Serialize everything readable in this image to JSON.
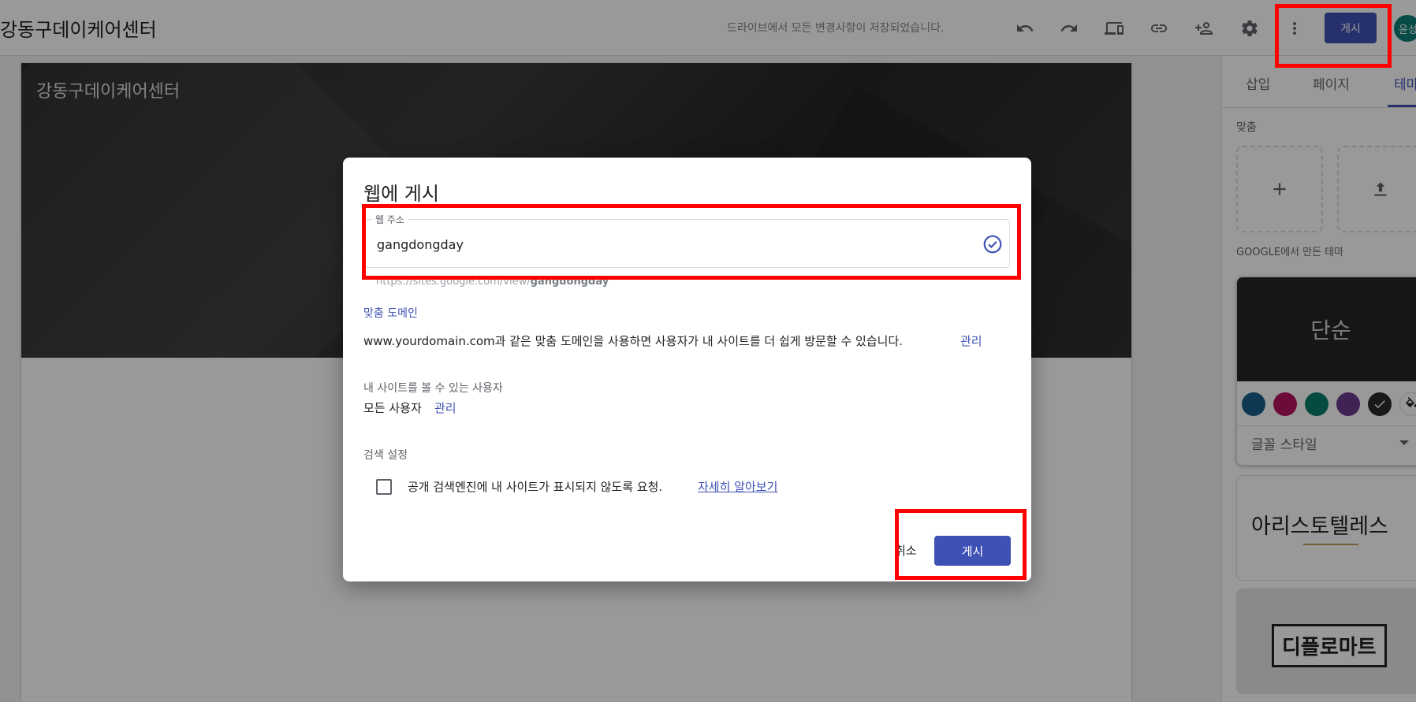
{
  "header": {
    "site_title": "강동구데이케어센터",
    "save_status": "드라이브에서 모든 변경사항이 저장되었습니다.",
    "publish_label": "게시",
    "avatar_text": "윤성",
    "icons": [
      "undo-icon",
      "redo-icon",
      "preview-devices-icon",
      "link-icon",
      "share-person-add-icon",
      "gear-icon",
      "more-vert-icon"
    ]
  },
  "canvas": {
    "header_title": "강동구데이케어센터"
  },
  "side_panel": {
    "tabs": [
      "삽입",
      "페이지",
      "테마"
    ],
    "active_tab": "테마",
    "custom_label": "맞춤",
    "google_themes_label": "GOOGLE에서 만든 테마",
    "themes": {
      "simple_name": "단순",
      "font_style_label": "글꼴 스타일",
      "swatch_colors": [
        "#1a5f8a",
        "#b5135e",
        "#0b7d6a",
        "#6b3a8e",
        "#2a2a2a"
      ],
      "aristotle_name": "아리스토텔레스",
      "diplomat_name": "디플로마트"
    }
  },
  "dialog": {
    "title": "웹에 게시",
    "url_field_label": "웹 주소",
    "url_value": "gangdongday",
    "url_helper_prefix": "https://sites.google.com/view/",
    "url_helper_slug": "gangdongday",
    "custom_domain_label": "맞춤 도메인",
    "custom_domain_text": "www.yourdomain.com과 같은 맞춤 도메인을 사용하면 사용자가 내 사이트를 더 쉽게 방문할 수 있습니다.",
    "custom_domain_manage": "관리",
    "viewers_label": "내 사이트를 볼 수 있는 사용자",
    "viewers_value": "모든 사용자",
    "viewers_manage": "관리",
    "search_label": "검색 설정",
    "search_checkbox_text": "공개 검색엔진에 내 사이트가 표시되지 않도록 요청.",
    "learn_more": "자세히 알아보기",
    "cancel_label": "취소",
    "publish_label": "게시"
  },
  "colors": {
    "accent": "#3f51b5",
    "annotation_red": "#ff0000"
  }
}
